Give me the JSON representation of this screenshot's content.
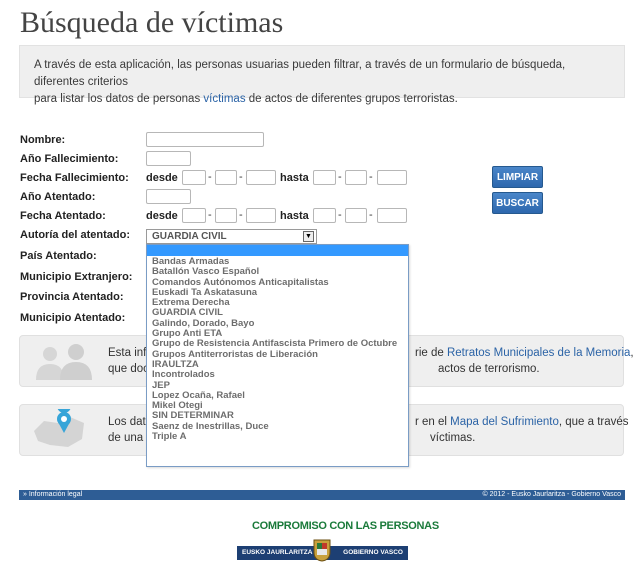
{
  "page": {
    "title": "Búsqueda de víctimas",
    "intro_part1": "A través de esta aplicación, las personas usuarias pueden filtrar, a través de un formulario de búsqueda, diferentes criterios",
    "intro_part2": "para listar los datos de personas ",
    "intro_link": "víctimas",
    "intro_part3": " de actos de diferentes grupos terroristas."
  },
  "form": {
    "nombre_label": "Nombre:",
    "anio_fallecimiento_label": "Año Fallecimiento:",
    "fecha_fallecimiento_label": "Fecha Fallecimiento:",
    "anio_atentado_label": "Año Atentado:",
    "fecha_atentado_label": "Fecha Atentado:",
    "autoria_label": "Autoría del atentado:",
    "pais_label": "País Atentado:",
    "municipio_extranjero_label": "Municipio Extranjero:",
    "provincia_label": "Provincia Atentado:",
    "municipio_label": "Municipio Atentado:",
    "desde_label": "desde",
    "hasta_label": "hasta",
    "dash": "-",
    "autoria_selected": "GUARDIA CIVIL"
  },
  "buttons": {
    "limpiar": "LIMPIAR",
    "buscar": "BUSCAR"
  },
  "dropdown": {
    "options": [
      "Bandas Armadas",
      "Batallón Vasco Español",
      "Comandos Autónomos Anticapitalistas",
      "Euskadi Ta Askatasuna",
      "Extrema Derecha",
      "GUARDIA CIVIL",
      "Galindo, Dorado, Bayo",
      "Grupo Anti ETA",
      "Grupo de Resistencia Antifascista Primero de Octubre",
      "Grupos Antiterroristas de Liberación",
      "IRAULTZA",
      "Incontrolados",
      "JEP",
      "Lopez Ocaña, Rafael",
      "Mikel Otegi",
      "SIN DETERMINAR",
      "Saenz de Inestrillas, Duce",
      "Triple A"
    ]
  },
  "panel1": {
    "line1_start": "Esta info",
    "line1_mid": "rie de ",
    "line1_link": "Retratos Municipales de la Memoria",
    "line1_end": ",",
    "line2_start": "que docu",
    "line2_end": "actos de terrorismo."
  },
  "panel2": {
    "line1_start": "Los dato",
    "line1_mid": "r en el ",
    "line1_link": "Mapa del Sufrimiento",
    "line1_end": ", que a través",
    "line2_start": "de una a",
    "line2_end": "víctimas."
  },
  "footer": {
    "legal": "» Información legal",
    "copyright": "© 2012 - Eusko Jaurlaritza - Gobierno Vasco",
    "slogan": "COMPROMISO CON LAS PERSONAS",
    "gob_left": "EUSKO JAURLARITZA",
    "gob_right": "GOBIERNO VASCO"
  },
  "colors": {
    "accent": "#2b63a6",
    "button": "#3a76bb",
    "highlight": "#3399ff",
    "slogan": "#1a7a3a",
    "footer_bar": "#2e5d95"
  }
}
